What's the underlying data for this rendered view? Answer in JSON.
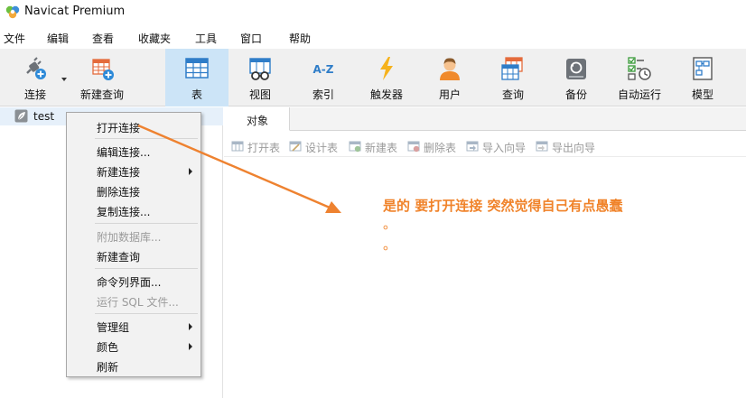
{
  "window": {
    "title": "Navicat Premium"
  },
  "menubar": [
    "文件",
    "编辑",
    "查看",
    "收藏夹",
    "工具",
    "窗口",
    "帮助"
  ],
  "toolbar": {
    "items": [
      {
        "label": "连接",
        "icon": "plug-connection-icon"
      },
      {
        "label": "新建查询",
        "icon": "new-query-icon"
      },
      {
        "label": "表",
        "icon": "table-icon",
        "active": true
      },
      {
        "label": "视图",
        "icon": "view-icon"
      },
      {
        "label": "索引",
        "icon": "index-az-icon",
        "icon_text": "A-Z"
      },
      {
        "label": "触发器",
        "icon": "trigger-lightning-icon"
      },
      {
        "label": "用户",
        "icon": "user-icon"
      },
      {
        "label": "查询",
        "icon": "query-icon"
      },
      {
        "label": "备份",
        "icon": "backup-icon"
      },
      {
        "label": "自动运行",
        "icon": "automation-icon"
      },
      {
        "label": "模型",
        "icon": "model-icon"
      }
    ]
  },
  "navigator": {
    "connection": "test"
  },
  "tabs": [
    {
      "label": "对象"
    }
  ],
  "object_toolbar": [
    {
      "label": "打开表",
      "icon": "open-table-icon"
    },
    {
      "label": "设计表",
      "icon": "design-table-icon"
    },
    {
      "label": "新建表",
      "icon": "new-table-icon"
    },
    {
      "label": "删除表",
      "icon": "delete-table-icon"
    },
    {
      "label": "导入向导",
      "icon": "import-wizard-icon"
    },
    {
      "label": "导出向导",
      "icon": "export-wizard-icon"
    }
  ],
  "context_menu": {
    "items": [
      {
        "label": "打开连接"
      },
      {
        "label": "编辑连接..."
      },
      {
        "label": "新建连接",
        "submenu": true
      },
      {
        "label": "删除连接"
      },
      {
        "label": "复制连接..."
      },
      {
        "label": "附加数据库...",
        "disabled": true
      },
      {
        "label": "新建查询"
      },
      {
        "label": "命令列界面..."
      },
      {
        "label": "运行 SQL 文件...",
        "disabled": true
      },
      {
        "label": "管理组",
        "submenu": true
      },
      {
        "label": "颜色",
        "submenu": true
      },
      {
        "label": "刷新"
      }
    ]
  },
  "annotation": {
    "text": "是的 要打开连接 突然觉得自己有点愚蠢",
    "dots": [
      "。",
      "。"
    ],
    "color": "#f0832a"
  }
}
